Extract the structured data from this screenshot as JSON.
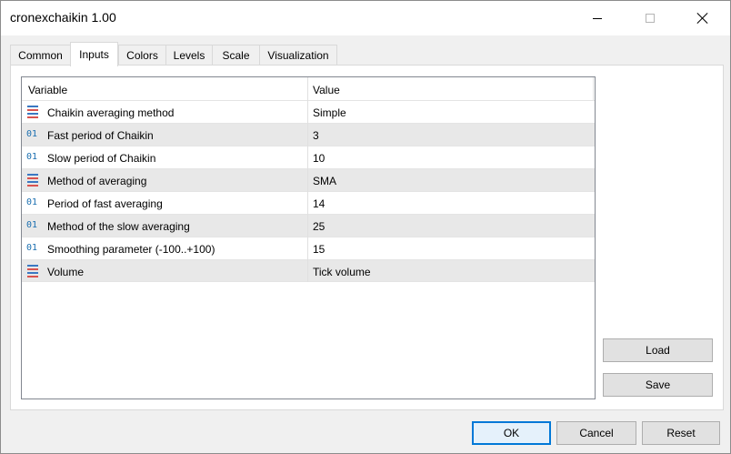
{
  "window": {
    "title": "cronexchaikin 1.00"
  },
  "tabs": [
    {
      "label": "Common"
    },
    {
      "label": "Inputs"
    },
    {
      "label": "Colors"
    },
    {
      "label": "Levels"
    },
    {
      "label": "Scale"
    },
    {
      "label": "Visualization"
    }
  ],
  "active_tab": "Inputs",
  "grid": {
    "columns": [
      "Variable",
      "Value"
    ],
    "rows": [
      {
        "icon": "enum-list-icon",
        "variable": "Chaikin averaging method",
        "value": "Simple"
      },
      {
        "icon": "numeric-icon",
        "variable": "Fast period of Chaikin",
        "value": "3"
      },
      {
        "icon": "numeric-icon",
        "variable": "Slow period of Chaikin",
        "value": "10"
      },
      {
        "icon": "enum-list-icon",
        "variable": "Method of averaging",
        "value": "SMA"
      },
      {
        "icon": "numeric-icon",
        "variable": "Period of fast averaging",
        "value": "14"
      },
      {
        "icon": "numeric-icon",
        "variable": "Method of the slow averaging",
        "value": "25"
      },
      {
        "icon": "numeric-icon",
        "variable": "Smoothing parameter (-100..+100)",
        "value": "15"
      },
      {
        "icon": "enum-list-icon",
        "variable": "Volume",
        "value": "Tick volume"
      }
    ]
  },
  "side_buttons": {
    "load": "Load",
    "save": "Save"
  },
  "footer_buttons": {
    "ok": "OK",
    "cancel": "Cancel",
    "reset": "Reset"
  },
  "icon_glyphs": {
    "numeric": "01"
  },
  "colors": {
    "accent": "#0078d7",
    "numeric_icon": "#1a6fb0",
    "enum_red": "#d9534f",
    "enum_blue": "#3a78c2"
  }
}
